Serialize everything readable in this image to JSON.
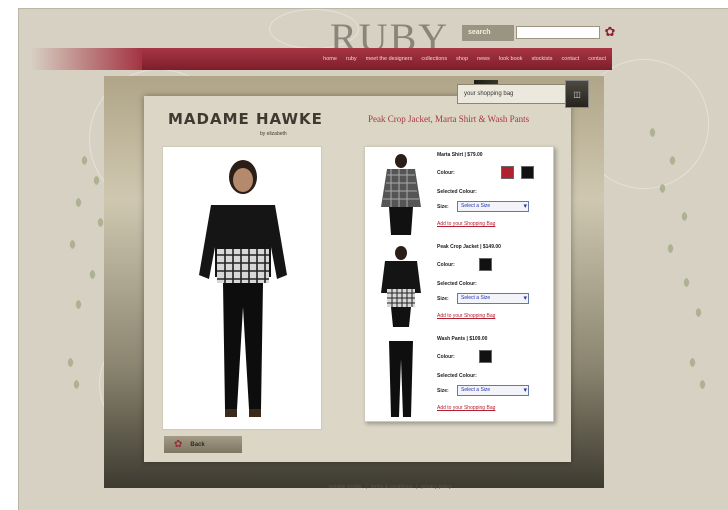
{
  "site": {
    "logo": "RUBY"
  },
  "search": {
    "label": "search",
    "value": ""
  },
  "nav": [
    "home",
    "ruby",
    "meet the designers",
    "collections",
    "shop",
    "news",
    "look book",
    "stockists",
    "contact",
    "contact"
  ],
  "bag": {
    "label": "your shopping bag"
  },
  "designer": {
    "name": "MADAME HAWKE",
    "subtitle": "by elizabeth"
  },
  "product": {
    "title": "Peak Crop Jacket, Marta Shirt & Wash Pants"
  },
  "items": [
    {
      "name": "Marta Shirt | $79.00",
      "colours": [
        "#b0202e",
        "#111111"
      ]
    },
    {
      "name": "Peak Crop Jacket | $149.00",
      "colours": [
        "#111111"
      ]
    },
    {
      "name": "Wash Pants | $109.00",
      "colours": [
        "#111111"
      ]
    }
  ],
  "labels": {
    "colour": "Colour:",
    "selected_colour": "Selected Colour:",
    "size": "Size:",
    "size_select": "Select a Size",
    "add": "Add to your Shopping Bag"
  },
  "back": {
    "label": "Back"
  },
  "footer": [
    "website credits",
    "|",
    "terms & conditions",
    "|",
    "privacy policy"
  ],
  "colors": {
    "accent": "#a83644",
    "background": "#d7d1c4"
  }
}
